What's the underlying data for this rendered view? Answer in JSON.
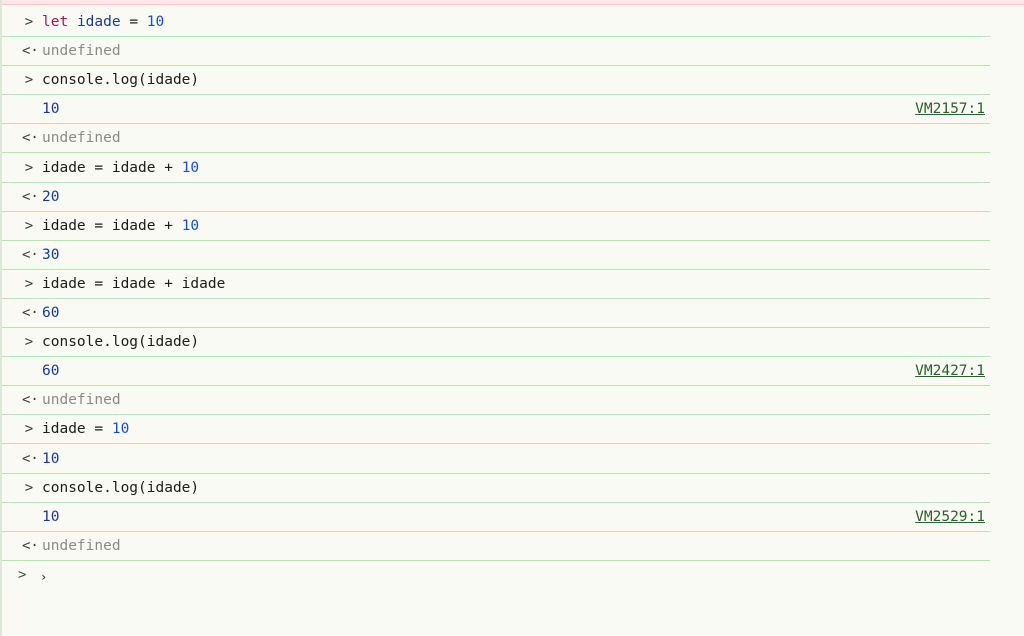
{
  "console": {
    "rows": [
      {
        "gutter": ">",
        "kind": "input",
        "tokens": [
          {
            "t": "let",
            "c": "kw"
          },
          {
            "t": " ",
            "c": "plain"
          },
          {
            "t": "idade",
            "c": "var"
          },
          {
            "t": " = ",
            "c": "plain"
          },
          {
            "t": "10",
            "c": "num"
          }
        ]
      },
      {
        "gutter": "<·",
        "kind": "result",
        "tokens": [
          {
            "t": "undefined",
            "c": "muted"
          }
        ]
      },
      {
        "gutter": ">",
        "kind": "input",
        "tokens": [
          {
            "t": "console.log(idade)",
            "c": "plain"
          }
        ]
      },
      {
        "gutter": "",
        "kind": "log",
        "tokens": [
          {
            "t": "10",
            "c": "value"
          }
        ],
        "source": "VM2157:1"
      },
      {
        "gutter": "<·",
        "kind": "result",
        "tokens": [
          {
            "t": "undefined",
            "c": "muted"
          }
        ]
      },
      {
        "gutter": ">",
        "kind": "input",
        "tokens": [
          {
            "t": "idade = idade + ",
            "c": "plain"
          },
          {
            "t": "10",
            "c": "num"
          }
        ]
      },
      {
        "gutter": "<·",
        "kind": "result",
        "tokens": [
          {
            "t": "20",
            "c": "value"
          }
        ]
      },
      {
        "gutter": ">",
        "kind": "input",
        "tokens": [
          {
            "t": "idade = idade + ",
            "c": "plain"
          },
          {
            "t": "10",
            "c": "num"
          }
        ]
      },
      {
        "gutter": "<·",
        "kind": "result",
        "tokens": [
          {
            "t": "30",
            "c": "value"
          }
        ]
      },
      {
        "gutter": ">",
        "kind": "input",
        "tokens": [
          {
            "t": "idade = idade + idade",
            "c": "plain"
          }
        ]
      },
      {
        "gutter": "<·",
        "kind": "result",
        "tokens": [
          {
            "t": "60",
            "c": "value"
          }
        ]
      },
      {
        "gutter": ">",
        "kind": "input",
        "tokens": [
          {
            "t": "console.log(idade)",
            "c": "plain"
          }
        ]
      },
      {
        "gutter": "",
        "kind": "log",
        "tokens": [
          {
            "t": "60",
            "c": "value"
          }
        ],
        "source": "VM2427:1"
      },
      {
        "gutter": "<·",
        "kind": "result",
        "tokens": [
          {
            "t": "undefined",
            "c": "muted"
          }
        ]
      },
      {
        "gutter": ">",
        "kind": "input",
        "tokens": [
          {
            "t": "idade = ",
            "c": "plain"
          },
          {
            "t": "10",
            "c": "num"
          }
        ]
      },
      {
        "gutter": "<·",
        "kind": "result",
        "tokens": [
          {
            "t": "10",
            "c": "value"
          }
        ]
      },
      {
        "gutter": ">",
        "kind": "input",
        "tokens": [
          {
            "t": "console.log(idade)",
            "c": "plain"
          }
        ]
      },
      {
        "gutter": "",
        "kind": "log",
        "tokens": [
          {
            "t": "10",
            "c": "value"
          }
        ],
        "source": "VM2529:1"
      },
      {
        "gutter": "<·",
        "kind": "result",
        "tokens": [
          {
            "t": "undefined",
            "c": "muted"
          }
        ]
      }
    ],
    "prompt_symbol": ">",
    "caret_symbol": "›",
    "input_value": ""
  },
  "colors": {
    "background": "#f9faf3",
    "row_border": "#b8e5b2",
    "keyword": "#a5125f",
    "number": "#1a4ec8",
    "value": "#1a3b8c",
    "muted": "#8a8a8a",
    "source_link": "#2c5f2e"
  }
}
